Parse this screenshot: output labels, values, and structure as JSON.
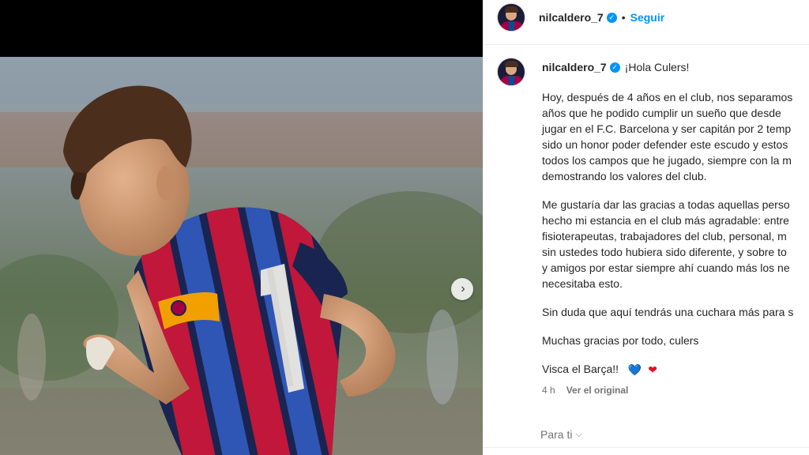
{
  "post": {
    "username": "nilcaldero_7",
    "follow_label": "Seguir",
    "separator": "•",
    "verified_glyph": "✓"
  },
  "caption": {
    "greeting": "¡Hola Culers!",
    "para1": [
      "Hoy, después de 4 años en el club, nos separamos",
      "años que he podido cumplir un sueño que desde",
      "jugar en el F.C. Barcelona y ser capitán por 2 temp",
      "sido un honor poder defender este escudo y estos",
      "todos los campos que he jugado, siempre con la m",
      "demostrando los valores del club."
    ],
    "para2": [
      "Me gustaría dar las gracias a todas aquellas perso",
      "hecho mi estancia en el club más agradable: entre",
      "fisioterapeutas, trabajadores del club, personal, m",
      "sin ustedes todo hubiera sido diferente, y sobre to",
      "y amigos por estar siempre ahí cuando más los ne",
      "necesitaba esto."
    ],
    "para3": "Sin duda que aquí tendrás una cuchara más para s",
    "para4": "Muchas gracias por todo, culers",
    "para5": "Visca el Barça!!",
    "hearts": [
      "💙",
      "❤"
    ],
    "heart_colors": [
      "#1d7be0",
      "#e0102a"
    ],
    "time_ago": "4 h",
    "see_original": "Ver el original"
  },
  "footer": {
    "for_you": "Para ti",
    "chevron": "⌵"
  },
  "media": {
    "next_glyph": "›",
    "jersey_number": "7",
    "colors": {
      "blaugrana_red": "#a50044",
      "blaugrana_blue": "#004d98",
      "armband": "#f2a000"
    }
  }
}
